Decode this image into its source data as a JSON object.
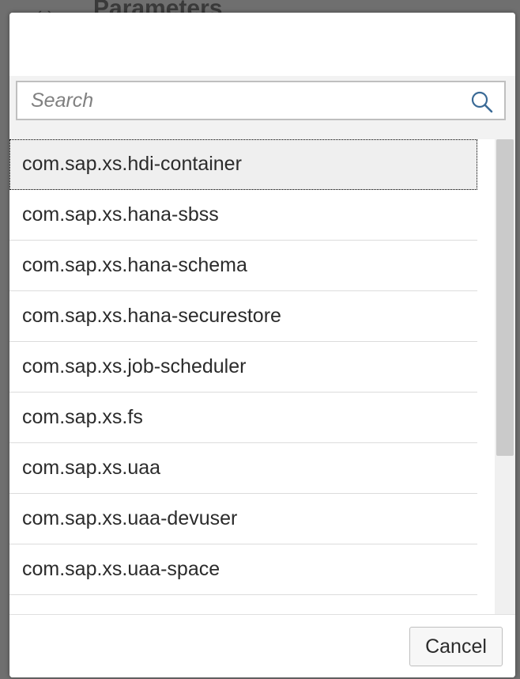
{
  "background": {
    "title": "Parameters"
  },
  "dialog": {
    "search": {
      "placeholder": "Search",
      "value": "",
      "icon": "search-icon"
    },
    "items": [
      {
        "label": "com.sap.xs.hdi-container",
        "selected": true
      },
      {
        "label": "com.sap.xs.hana-sbss",
        "selected": false
      },
      {
        "label": "com.sap.xs.hana-schema",
        "selected": false
      },
      {
        "label": "com.sap.xs.hana-securestore",
        "selected": false
      },
      {
        "label": "com.sap.xs.job-scheduler",
        "selected": false
      },
      {
        "label": "com.sap.xs.fs",
        "selected": false
      },
      {
        "label": "com.sap.xs.uaa",
        "selected": false
      },
      {
        "label": "com.sap.xs.uaa-devuser",
        "selected": false
      },
      {
        "label": "com.sap.xs.uaa-space",
        "selected": false
      }
    ],
    "cancel_label": "Cancel"
  },
  "colors": {
    "selected_row": "#efefef",
    "overlay": "#6f6f6f",
    "search_icon": "#3a6a96"
  }
}
